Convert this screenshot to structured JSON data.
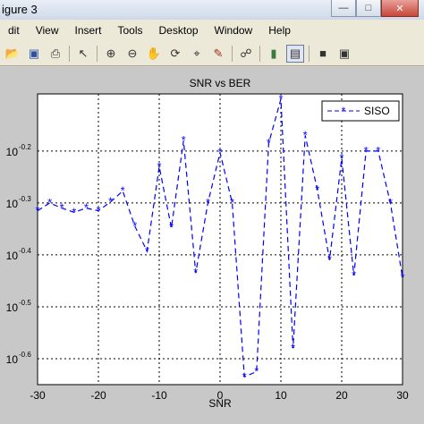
{
  "window": {
    "title": "igure 3",
    "minimize_icon": "minimize-icon",
    "maximize_icon": "maximize-icon"
  },
  "menu": {
    "items": [
      "dit",
      "View",
      "Insert",
      "Tools",
      "Desktop",
      "Window",
      "Help"
    ]
  },
  "toolbar": {
    "icons": [
      "open-folder-icon",
      "save-icon",
      "print-icon",
      "pointer-icon",
      "zoom-in-icon",
      "zoom-out-icon",
      "pan-hand-icon",
      "rotate-icon",
      "data-cursor-icon",
      "brush-icon",
      "link-icon",
      "colorbar-icon",
      "legend-icon",
      "hide-tools-icon",
      "show-tools-icon"
    ]
  },
  "chart_data": {
    "type": "line",
    "title": "SNR vs BER",
    "xlabel": "SNR",
    "ylabel": "",
    "xlim": [
      -30,
      30
    ],
    "ylim_log10": [
      -0.65,
      -0.09
    ],
    "y_scale": "log",
    "x_ticks": [
      "-30",
      "-20",
      "-10",
      "0",
      "10",
      "20",
      "30"
    ],
    "y_ticks": [
      {
        "exp": "-0.2",
        "value": -0.2
      },
      {
        "exp": "-0.3",
        "value": -0.3
      },
      {
        "exp": "-0.4",
        "value": -0.4
      },
      {
        "exp": "-0.5",
        "value": -0.5
      },
      {
        "exp": "-0.6",
        "value": -0.6
      }
    ],
    "grid": true,
    "legend_position": "top-right",
    "series": [
      {
        "name": "SISO",
        "color": "#0000ff",
        "x": [
          -30,
          -28,
          -26,
          -24,
          -22,
          -20,
          -18,
          -16,
          -14,
          -12,
          -10,
          -8,
          -6,
          -4,
          -2,
          0,
          2,
          4,
          6,
          8,
          10,
          12,
          14,
          16,
          18,
          20,
          22,
          24,
          26,
          28,
          30
        ],
        "log10_y": [
          -0.315,
          -0.3,
          -0.31,
          -0.318,
          -0.31,
          -0.315,
          -0.298,
          -0.277,
          -0.345,
          -0.393,
          -0.23,
          -0.348,
          -0.18,
          -0.435,
          -0.3,
          -0.203,
          -0.3,
          -0.635,
          -0.625,
          -0.185,
          -0.1,
          -0.58,
          -0.17,
          -0.275,
          -0.41,
          -0.214,
          -0.44,
          -0.2,
          -0.2,
          -0.3,
          -0.444
        ]
      }
    ]
  }
}
